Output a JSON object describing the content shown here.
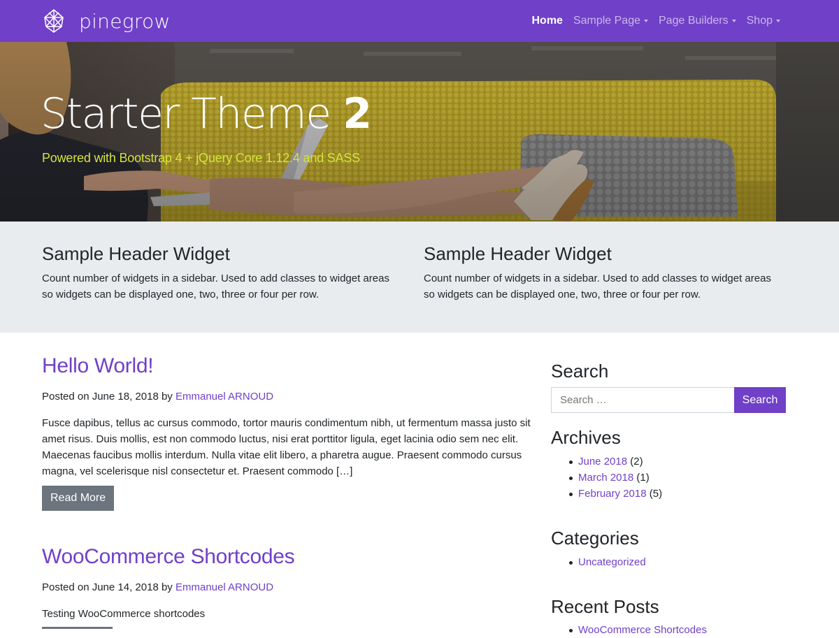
{
  "navbar": {
    "brand": "pinegrow",
    "items": [
      {
        "label": "Home",
        "active": true,
        "dropdown": false
      },
      {
        "label": "Sample Page",
        "active": false,
        "dropdown": true
      },
      {
        "label": "Page Builders",
        "active": false,
        "dropdown": true
      },
      {
        "label": "Shop",
        "active": false,
        "dropdown": true
      }
    ]
  },
  "hero": {
    "title_light": "Starter Theme",
    "title_bold": "2",
    "subtitle": "Powered with Bootstrap 4 + jQuery Core 1.12.4 and SASS"
  },
  "header_widgets": [
    {
      "title": "Sample Header Widget",
      "text": "Count number of widgets in a sidebar. Used to add classes to widget areas so widgets can be displayed one, two, three or four per row."
    },
    {
      "title": "Sample Header Widget",
      "text": "Count number of widgets in a sidebar. Used to add classes to widget areas so widgets can be displayed one, two, three or four per row."
    }
  ],
  "posts": [
    {
      "title": "Hello World!",
      "posted_prefix": "Posted on June 18, 2018 by",
      "author": "Emmanuel ARNOUD",
      "excerpt": "Fusce dapibus, tellus ac cursus commodo, tortor mauris condimentum nibh, ut fermentum massa justo sit amet risus. Duis mollis, est non commodo luctus, nisi erat porttitor ligula, eget lacinia odio sem nec elit. Maecenas faucibus mollis interdum. Nulla vitae elit libero, a pharetra augue. Praesent commodo cursus magna, vel scelerisque nisl consectetur et. Praesent commodo […]",
      "read_more": "Read More"
    },
    {
      "title": "WooCommerce Shortcodes",
      "posted_prefix": "Posted on June 14, 2018 by",
      "author": "Emmanuel ARNOUD",
      "excerpt": "Testing WooCommerce shortcodes"
    }
  ],
  "sidebar": {
    "search": {
      "title": "Search",
      "placeholder": "Search …",
      "button": "Search"
    },
    "archives": {
      "title": "Archives",
      "items": [
        {
          "label": "June 2018",
          "count": "(2)"
        },
        {
          "label": "March 2018",
          "count": "(1)"
        },
        {
          "label": "February 2018",
          "count": "(5)"
        }
      ]
    },
    "categories": {
      "title": "Categories",
      "items": [
        {
          "label": "Uncategorized"
        }
      ]
    },
    "recent_posts": {
      "title": "Recent Posts",
      "items": [
        {
          "label": "WooCommerce Shortcodes"
        }
      ]
    }
  },
  "colors": {
    "brand": "#7040c8",
    "subtitle": "#d4e43a",
    "widget_bg": "#e9ecef",
    "button_secondary": "#6c757d"
  }
}
